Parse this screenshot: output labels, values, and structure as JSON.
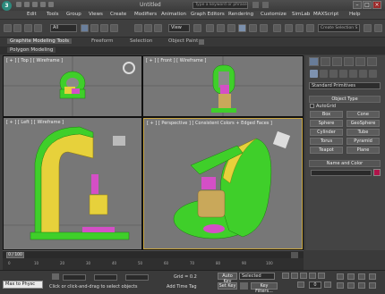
{
  "app": {
    "title": "Untitled",
    "search_placeholder": "Type a keyword or phrase",
    "logo_letter": "3"
  },
  "menu": [
    "Edit",
    "Tools",
    "Group",
    "Views",
    "Create",
    "Modifiers",
    "Animation",
    "Graph Editors",
    "Rendering",
    "Customize",
    "SimLab",
    "MAXScript",
    "Help"
  ],
  "toolbar": {
    "selection_filter": "All",
    "reference_coord": "View",
    "named_selection_set": "Create Selection S"
  },
  "ribbon": {
    "tabs": [
      "Graphite Modeling Tools",
      "Freeform",
      "Selection",
      "Object Paint"
    ],
    "subtab": "Polygon Modeling"
  },
  "viewports": {
    "top": "[ + ] [ Top ] [ Wireframe ]",
    "front": "[ + ] [ Front ] [ Wireframe ]",
    "left": "[ + ] [ Left ] [ Wireframe ]",
    "perspective": "[ + ] [ Perspective ] [ Consistent Colors + Edged Faces ]"
  },
  "command_panel": {
    "dropdown": "Standard Primitives",
    "object_type_header": "Object Type",
    "autogrid": "AutoGrid",
    "buttons": [
      "Box",
      "Cone",
      "Sphere",
      "GeoSphere",
      "Cylinder",
      "Tube",
      "Torus",
      "Pyramid",
      "Teapot",
      "Plane"
    ],
    "name_color_header": "Name and Color",
    "object_color": "#b0144a"
  },
  "timeline": {
    "slider": "0 / 100",
    "ticks": [
      "0",
      "10",
      "20",
      "30",
      "40",
      "50",
      "60",
      "70",
      "80",
      "90",
      "100"
    ]
  },
  "status": {
    "maxscript": "Max to Physc",
    "prompt": "Click or click-and-drag to select objects",
    "add_time_tag": "Add Time Tag",
    "grid": "Grid = 0.2",
    "auto_key": "Auto Key",
    "key_mode": "Selected",
    "set_key": "Set Key",
    "key_filters": "Key Filters...",
    "frame": "0"
  },
  "colors": {
    "model_green": "#3fcf2a",
    "model_magenta": "#d44fc6",
    "model_yellow": "#e7d13b",
    "model_tan": "#c9a85a",
    "active_viewport": "#c9a640"
  }
}
